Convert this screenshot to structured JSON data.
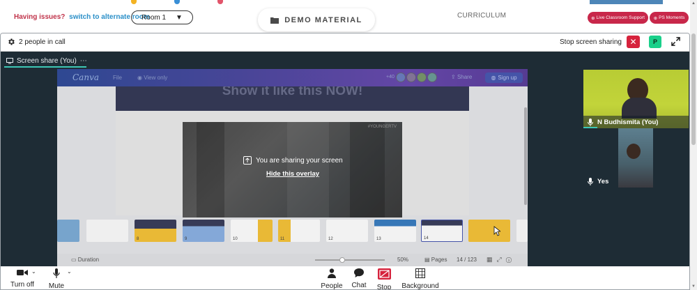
{
  "header": {
    "issue_text": "Having issues?",
    "issue_link": "switch to alternate room",
    "room_value": "Room 1",
    "room_caret": "▼",
    "demo_label": "DEMO MATERIAL",
    "curriculum_label": "CURRICULUM",
    "support_label": "Live Classroom Support",
    "moments_label": "PS Moments",
    "accent_color": "#c8274a"
  },
  "call": {
    "people_count": "2 people in call",
    "stop_sharing_label": "Stop screen sharing",
    "close_glyph": "✕",
    "presenter_initial": "P",
    "share_tab_label": "Screen share (You)",
    "share_tab_more": "⋯"
  },
  "canva": {
    "logo": "Canva",
    "file_menu": "File",
    "view_only": "View only",
    "collaborator_count": "+40",
    "share_label": "Share",
    "signup_label": "Sign up",
    "slide_title": "Show it like this NOW!",
    "video_tag": "#YOUNGERTV",
    "overlay_message": "You are sharing your screen",
    "overlay_link": "Hide this overlay",
    "duration_label": "Duration",
    "zoom_value": "50%",
    "zoom_level": 0.5,
    "pages_label": "Pages",
    "page_counter": "14 / 123",
    "thumb_pages": [
      "",
      "",
      "8",
      "9",
      "10",
      "11",
      "12",
      "13",
      "14",
      ""
    ]
  },
  "participants": [
    {
      "name": "N Budhismita (You)"
    },
    {
      "name": "Yes"
    }
  ],
  "controls": {
    "camera_label": "Turn off",
    "mute_label": "Mute",
    "people_label": "People",
    "chat_label": "Chat",
    "stop_label": "Stop",
    "background_label": "Background"
  },
  "icons": [
    "gear-icon",
    "close-icon",
    "expand-icon",
    "monitor-icon",
    "camera-icon",
    "microphone-icon",
    "person-icon",
    "chat-bubble-icon",
    "stop-share-icon",
    "background-icon",
    "folder-icon",
    "upload-icon",
    "cursor-icon"
  ]
}
